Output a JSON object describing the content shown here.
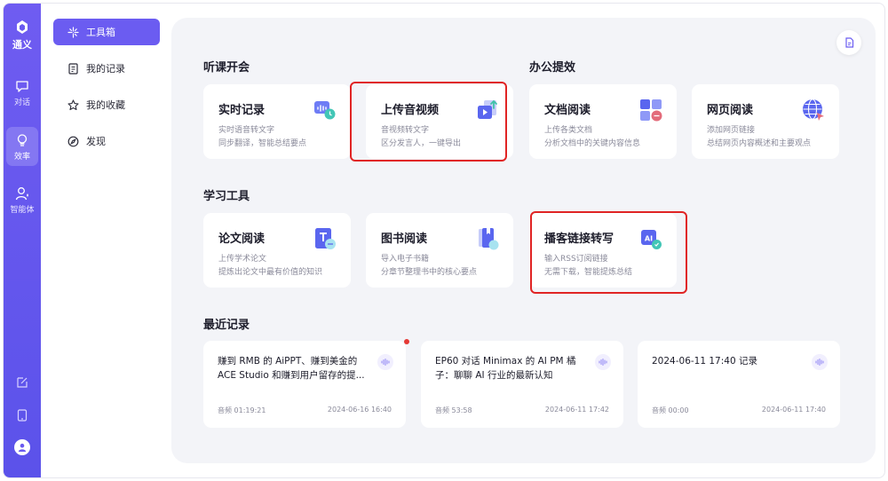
{
  "rail": {
    "logo_label": "通义",
    "items": [
      {
        "label": "对话"
      },
      {
        "label": "效率"
      },
      {
        "label": "智能体"
      }
    ]
  },
  "nav": {
    "items": [
      {
        "label": "工具箱"
      },
      {
        "label": "我的记录"
      },
      {
        "label": "我的收藏"
      },
      {
        "label": "发现"
      }
    ]
  },
  "sections": {
    "listen": "听课开会",
    "office": "办公提效",
    "study": "学习工具",
    "recent": "最近记录"
  },
  "cards": [
    {
      "title": "实时记录",
      "line1": "实时语音转文字",
      "line2": "同步翻译，智能总结要点"
    },
    {
      "title": "上传音视频",
      "line1": "音视频转文字",
      "line2": "区分发言人，一键导出"
    },
    {
      "title": "文档阅读",
      "line1": "上传各类文档",
      "line2": "分析文档中的关键内容信息"
    },
    {
      "title": "网页阅读",
      "line1": "添加网页链接",
      "line2": "总结网页内容概述和主要观点"
    },
    {
      "title": "论文阅读",
      "line1": "上传学术论文",
      "line2": "提炼出论文中最有价值的知识"
    },
    {
      "title": "图书阅读",
      "line1": "导入电子书籍",
      "line2": "分章节整理书中的核心要点"
    },
    {
      "title": "播客链接转写",
      "line1": "输入RSS订阅链接",
      "line2": "无需下载，智能提炼总结"
    }
  ],
  "recent": [
    {
      "title": "赚到 RMB 的 AiPPT、赚到美金的 ACE Studio 和赚到用户留存的提...",
      "type": "音频 01:19:21",
      "time": "2024-06-16 16:40"
    },
    {
      "title": "EP60 对话 Minimax 的 AI PM 橘子：聊聊 AI 行业的最新认知",
      "type": "音频 53:58",
      "time": "2024-06-11 17:42"
    },
    {
      "title": "2024-06-11 17:40 记录",
      "type": "音频 00:00",
      "time": "2024-06-11 17:40"
    }
  ],
  "colors": {
    "accent": "#6b5cf1",
    "highlight": "#e02424",
    "background": "#f3f4f8"
  }
}
